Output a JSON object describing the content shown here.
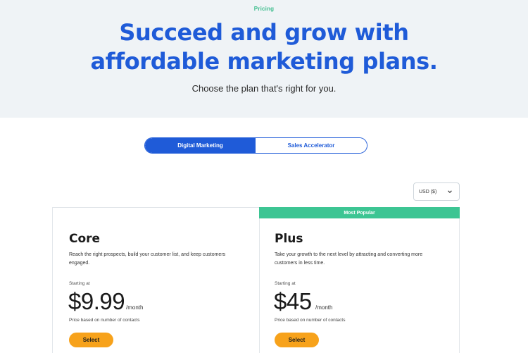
{
  "hero": {
    "eyebrow": "Pricing",
    "headline_line1": "Succeed and grow with",
    "headline_line2": "affordable marketing plans.",
    "subhead": "Choose the plan that's right for you."
  },
  "tabs": [
    {
      "label": "Digital Marketing",
      "active": true
    },
    {
      "label": "Sales Accelerator",
      "active": false
    }
  ],
  "currency": {
    "selected": "USD ($)",
    "icon": "chevron-down-icon"
  },
  "plans": [
    {
      "name": "Core",
      "description": "Reach the right prospects, build your customer list, and keep customers engaged.",
      "starting_label": "Starting at",
      "price": "$9.99",
      "period": "/month",
      "note": "Price based on number of contacts",
      "button": "Select"
    },
    {
      "badge": "Most Popular",
      "name": "Plus",
      "description": "Take your growth to the next level by attracting and converting more customers in less time.",
      "starting_label": "Starting at",
      "price": "$45",
      "period": "/month",
      "note": "Price based on number of contacts",
      "button": "Select"
    }
  ],
  "colors": {
    "brand_blue": "#1f5bd8",
    "accent_green": "#3cc593",
    "cta_orange": "#f7a21b",
    "hero_bg": "#eff3f6"
  }
}
